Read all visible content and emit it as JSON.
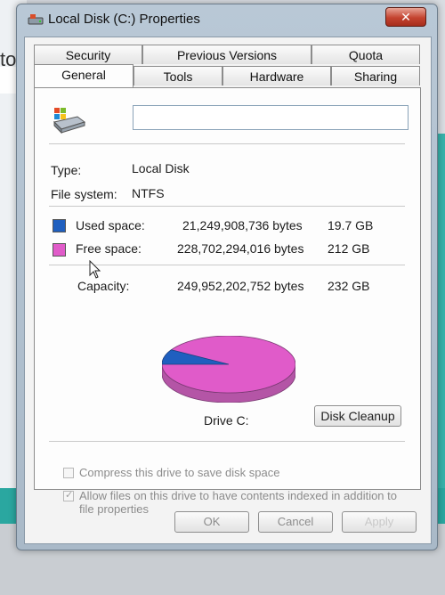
{
  "window": {
    "title": "Local Disk (C:) Properties",
    "close_glyph": "✕"
  },
  "tabs_back": [
    "Security",
    "Previous Versions",
    "Quota"
  ],
  "tabs_front": [
    "General",
    "Tools",
    "Hardware",
    "Sharing"
  ],
  "general": {
    "name_value": "",
    "type_label": "Type:",
    "type_value": "Local Disk",
    "fs_label": "File system:",
    "fs_value": "NTFS",
    "used": {
      "label": "Used space:",
      "bytes": "21,249,908,736 bytes",
      "size": "19.7 GB",
      "color": "#1f5fbf"
    },
    "free": {
      "label": "Free space:",
      "bytes": "228,702,294,016 bytes",
      "size": "212 GB",
      "color": "#e05bc9"
    },
    "capacity": {
      "label": "Capacity:",
      "bytes": "249,952,202,752 bytes",
      "size": "232 GB"
    },
    "drive_label": "Drive C:",
    "disk_cleanup": "Disk Cleanup",
    "compress_label": "Compress this drive to save disk space",
    "compress_checked": false,
    "index_label_line1": "Allow files on this drive to have contents indexed in addition to",
    "index_label_line2": "file properties",
    "index_checked": true,
    "used_fraction": 0.085
  },
  "buttons": {
    "ok": "OK",
    "cancel": "Cancel",
    "apply": "Apply"
  },
  "background": {
    "left_text": "to"
  }
}
